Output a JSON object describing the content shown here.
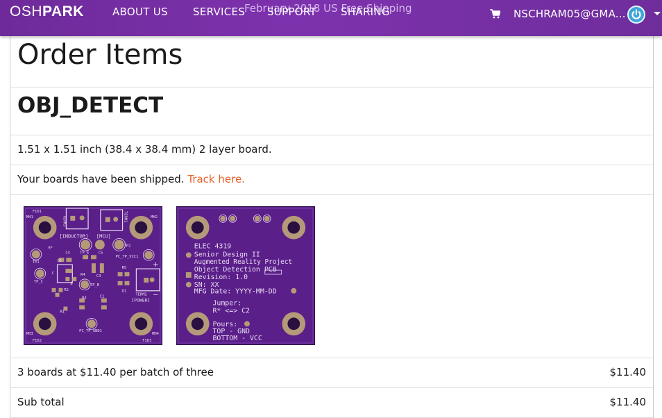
{
  "nav": {
    "logo_light": "OSH",
    "logo_bold": "PARK",
    "promo_text": "February 2018 US Free Shipping",
    "links": [
      "ABOUT US",
      "SERVICES",
      "SUPPORT",
      "SHARING"
    ],
    "cart_icon": "shopping-cart-icon",
    "user": "NSCHRAM05@GMA...",
    "power_icon": "power-icon",
    "dropdown_icon": "caret-down-icon"
  },
  "page": {
    "title": "Order Items"
  },
  "order": {
    "project_name": "OBJ_DETECT",
    "board_description": "1.51 x 1.51 inch (38.4 x 38.4 mm) 2 layer board.",
    "shipped_text": "Your boards have been shipped.",
    "track_link": "Track here.",
    "line_item_label": "3 boards at $11.40 per batch of three",
    "line_item_price": "$11.40",
    "subtotal_label": "Sub total",
    "subtotal_price": "$11.40"
  },
  "board_top": {
    "labels": [
      "FID1",
      "TERM3",
      "TERM1",
      "MH2",
      "MH1",
      "[INDUCTOR]",
      "[MCU]",
      "TP2",
      "R*",
      "C4",
      "TP_E",
      "C5",
      "TP1",
      "PC_TP_VCC1",
      "Q1",
      "C",
      "R4",
      "R5",
      "TP_C",
      "B",
      "C3",
      "TP_B",
      "R2",
      "Q1",
      "TERM2",
      "C1",
      "[POWER]",
      "R3",
      "R1",
      "MH3",
      "PC_TP_GND1",
      "MH4",
      "FID2",
      "FID3"
    ]
  },
  "board_bottom": {
    "lines": [
      "ELEC 4319",
      "Senior Design II",
      "Augmented Reality Project",
      "Object Detection PCB",
      "Revision: 1.0",
      "SN: XX",
      "MFG Date: YYYY-MM-DD",
      "Jumper:",
      "R* <=> C2",
      "Pours:",
      "TOP - GND",
      "BOTTOM - VCC"
    ]
  },
  "colors": {
    "nav_purple": "#7d32ad",
    "pcb_purple": "#5b1f8a",
    "silkscreen": "#e8dcf2",
    "link_orange": "#e8612c",
    "pad_gold": "#b59a7a"
  }
}
